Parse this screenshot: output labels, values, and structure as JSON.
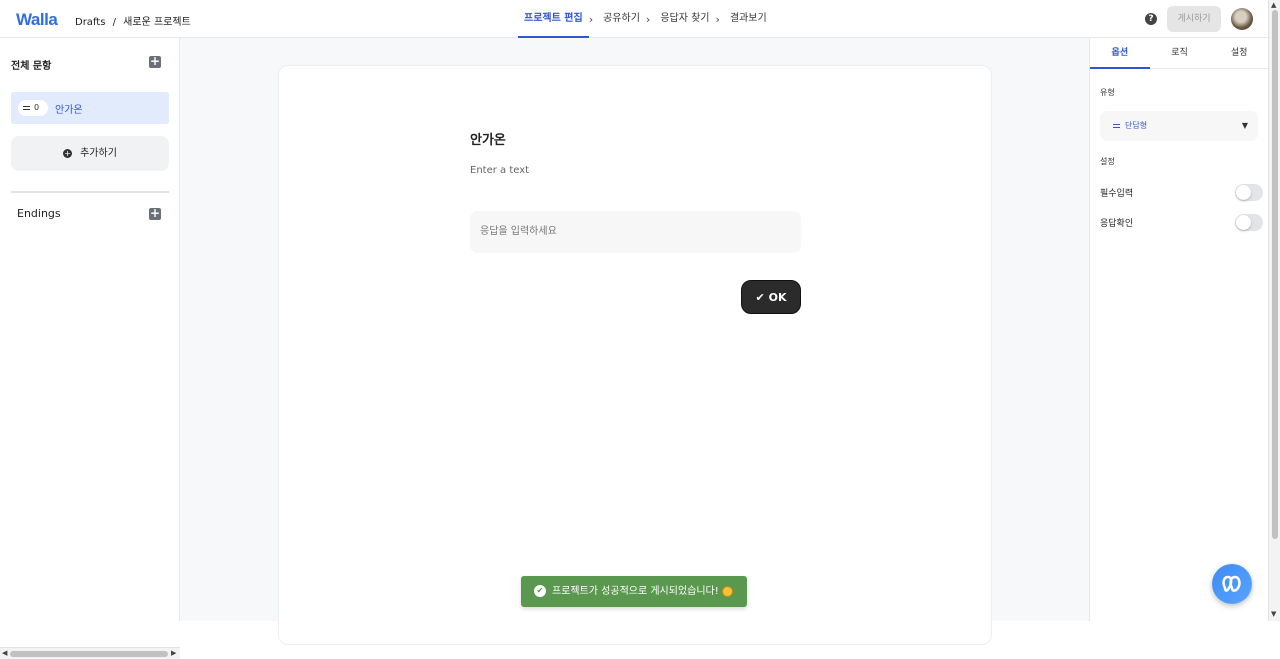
{
  "header": {
    "logo": "Walla",
    "breadcrumb_root": "Drafts",
    "breadcrumb_sep": "/",
    "breadcrumb_current": "새로운 프로젝트",
    "steps": [
      "프로젝트 편집",
      "공유하기",
      "응답자 찾기",
      "결과보기"
    ],
    "active_step": "프로젝트 편집",
    "publish_label": "게시하기"
  },
  "sidebar": {
    "title": "전체 문항",
    "question": {
      "index": "0",
      "label": "안가온"
    },
    "add_label": "추가하기",
    "endings_label": "Endings"
  },
  "editor": {
    "question_title": "안가온",
    "question_desc": "Enter a text",
    "answer_placeholder": "응답을 입력하세요",
    "ok_label": "OK"
  },
  "toast": {
    "message": "프로젝트가 성공적으로 게시되었습니다!"
  },
  "right_panel": {
    "tabs": [
      "옵션",
      "로직",
      "설정"
    ],
    "active_tab": "옵션",
    "type_label": "유형",
    "type_value": "단답형",
    "settings_label": "설정",
    "options": [
      {
        "label": "필수입력",
        "on": false
      },
      {
        "label": "응답확인",
        "on": false
      }
    ]
  },
  "colors": {
    "accent": "#2f55d4",
    "toast_bg": "#5a9850",
    "ok_button_bg": "#2b2b2b"
  }
}
